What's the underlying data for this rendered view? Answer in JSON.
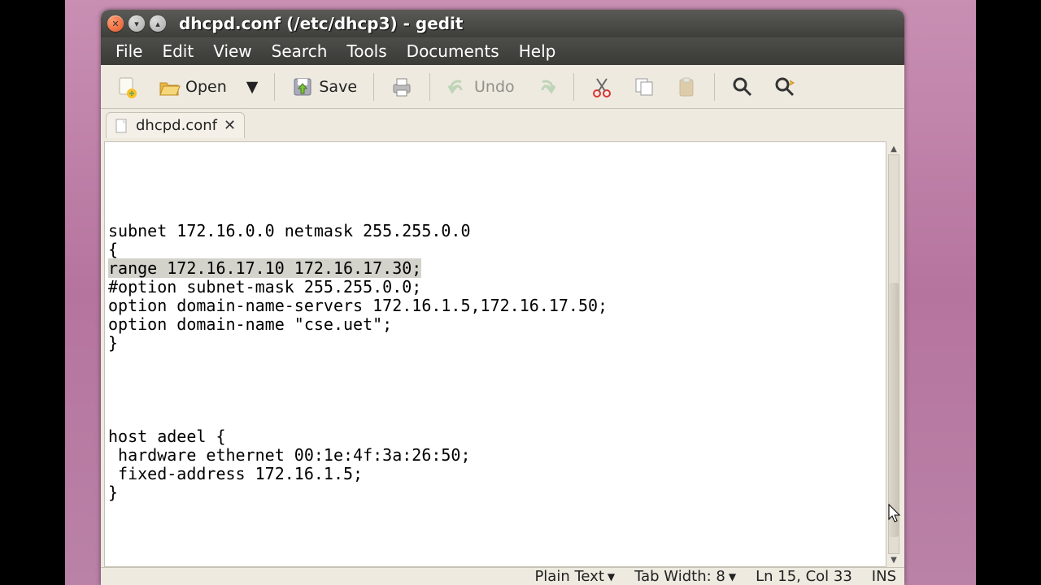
{
  "window": {
    "title": "dhcpd.conf (/etc/dhcp3) - gedit"
  },
  "menubar": [
    "File",
    "Edit",
    "View",
    "Search",
    "Tools",
    "Documents",
    "Help"
  ],
  "toolbar": {
    "new": "",
    "open": "Open",
    "save": "Save",
    "print": "",
    "undo": "Undo",
    "redo": "",
    "cut": "",
    "copy": "",
    "paste": "",
    "find": "",
    "replace": ""
  },
  "tab": {
    "label": "dhcpd.conf"
  },
  "editor": {
    "pre": "\n\n\n\nsubnet 172.16.0.0 netmask 255.255.0.0\n{\n",
    "highlight": "range 172.16.17.10 172.16.17.30;",
    "post": "\n#option subnet-mask 255.255.0.0;\noption domain-name-servers 172.16.1.5,172.16.17.50;\noption domain-name \"cse.uet\";\n}\n\n\n\n\nhost adeel {\n hardware ethernet 00:1e:4f:3a:26:50;\n fixed-address 172.16.1.5;\n}\n"
  },
  "statusbar": {
    "language": "Plain Text",
    "tabwidth": "Tab Width: 8",
    "position": "Ln 15, Col 33",
    "insert": "INS"
  }
}
